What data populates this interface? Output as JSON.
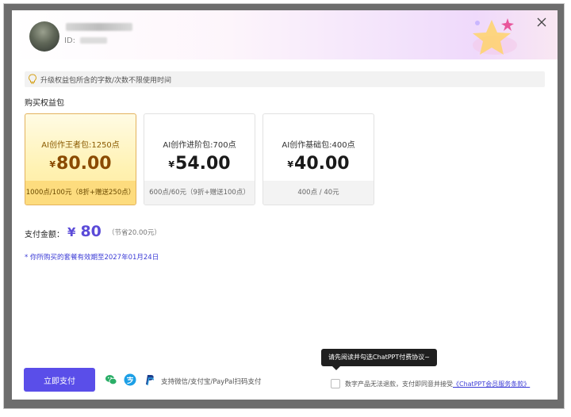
{
  "user": {
    "id_label": "ID:"
  },
  "tip": {
    "icon": "lightbulb-icon",
    "text": "升级权益包所含的字数/次数不限使用时间"
  },
  "section_title": "购买权益包",
  "packages": [
    {
      "title": "AI创作王者包:1250点",
      "currency": "¥",
      "price": "80.00",
      "detail": "1000点/100元（8折+赠送250点）",
      "selected": true
    },
    {
      "title": "AI创作进阶包:700点",
      "currency": "¥",
      "price": "54.00",
      "detail": "600点/60元（9折+赠送100点）",
      "selected": false
    },
    {
      "title": "AI创作基础包:400点",
      "currency": "¥",
      "price": "40.00",
      "detail": "400点 / 40元",
      "selected": false
    }
  ],
  "payment": {
    "label": "支付金额：",
    "currency": "¥",
    "amount": "80",
    "savings": "（节省20.00元）",
    "validity": "* 你所购买的套餐有效期至2027年01月24日"
  },
  "footer": {
    "pay_button": "立即支付",
    "methods_text": "支持微信/支付宝/PayPal扫码支付",
    "tooltip": "请先阅读并勾选ChatPPT付费协议~",
    "agreement_text": "数字产品无法退款，支付即同意并接受",
    "agreement_link": "《ChatPPT会员服务条款》"
  },
  "icons": [
    "wechat-pay-icon",
    "alipay-icon",
    "paypal-icon",
    "close-icon"
  ],
  "colors": {
    "accent": "#5a4ee9",
    "price_accent": "#5b4bd8",
    "selected_card": "#fff2b3",
    "selected_border": "#e3b25d"
  }
}
